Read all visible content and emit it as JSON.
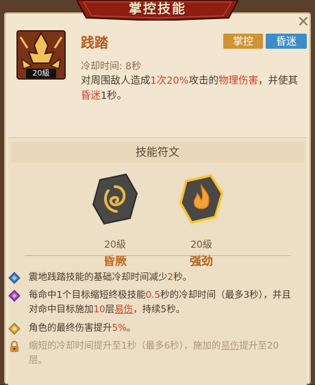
{
  "header": {
    "title": "掌控技能"
  },
  "skill": {
    "name": "践踏",
    "level_badge": "20級",
    "tags": [
      "掌控",
      "昏迷"
    ],
    "cooldown": "冷却时间: 8秒",
    "desc": {
      "p1": "对周围敌人造成",
      "p2": "1次",
      "p3": "20%",
      "p4": "攻击的",
      "p5": "物理伤害",
      "p6": "，并使其",
      "p7": "昏迷",
      "p8": "1秒。"
    }
  },
  "runes": {
    "title": "技能符文",
    "items": [
      {
        "level": "20級",
        "name": "昏厥",
        "name_color": "#c06a24"
      },
      {
        "level": "20級",
        "name": "强劲",
        "name_color": "#b5621c"
      }
    ]
  },
  "effects": [
    {
      "icon": "blue-diamond-icon",
      "color": "#3a76b8",
      "a": "震地践踏技能的基础冷却时间减少",
      "b": "2",
      "c": "秒。"
    },
    {
      "icon": "purple-diamond-icon",
      "color": "#9a3fb4",
      "a": "每命中1个目标缩短终极技能",
      "b": "0.5",
      "c": "秒的冷却时间（最多3秒），并且对命中目标施加",
      "d": "10",
      "e": "层",
      "f": "易伤",
      "g": "，持续5秒。"
    },
    {
      "icon": "gold-diamond-icon",
      "color": "#d2a23a",
      "a": "角色的最终伤害提升",
      "b": "5%",
      "c": "。"
    },
    {
      "icon": "lock-icon",
      "color": "#d08a3a",
      "a": "缩短的冷却时间提升至1秒（最多6秒），施加的",
      "b": "易伤",
      "c": "提升至20层。"
    }
  ]
}
